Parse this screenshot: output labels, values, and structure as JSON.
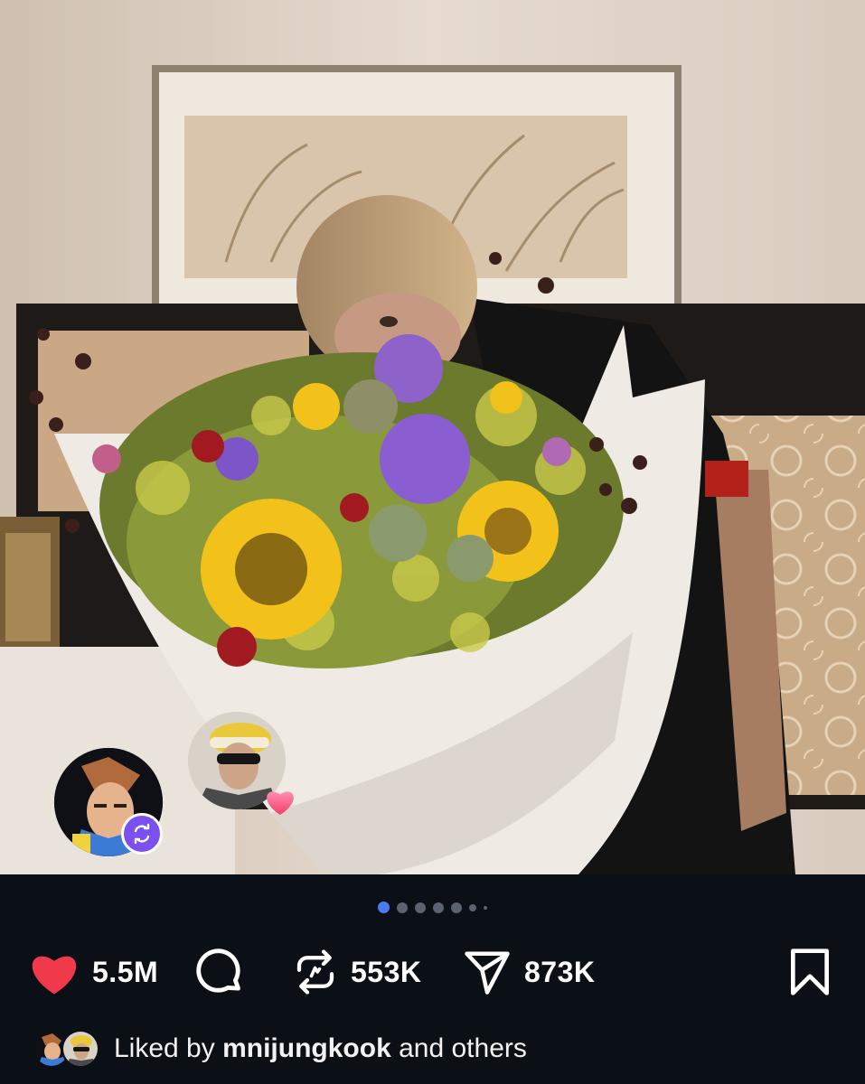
{
  "post": {
    "image_alt": "photo",
    "carousel": {
      "total": 7,
      "active_index": 0
    }
  },
  "actions": {
    "likes": "5.5M",
    "reposts": "553K",
    "shares": "873K"
  },
  "liked_by": {
    "prefix": "Liked by",
    "user": "mnijungkook",
    "suffix": "and others"
  },
  "colors": {
    "background": "#0b0f16",
    "heart": "#f0394a",
    "repost_badge": "#7b4ff0",
    "carousel_active": "#4a7cf0"
  },
  "icons": [
    "heart-icon",
    "comment-icon",
    "repost-icon",
    "share-icon",
    "bookmark-icon"
  ]
}
